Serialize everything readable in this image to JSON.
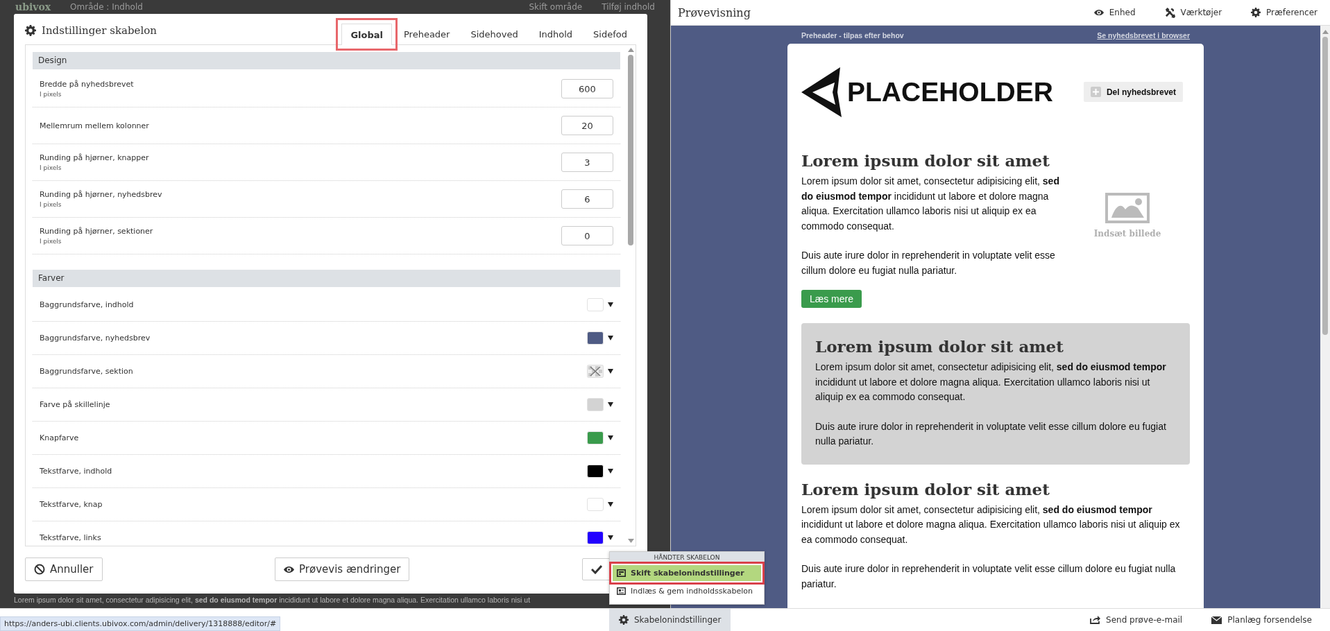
{
  "app": {
    "logo": "ubivox",
    "area": "Område : Indhold",
    "header_actions": [
      "Skift område",
      "Tilføj indhold"
    ],
    "background_text": "Lorem ipsum dolor sit amet, consectetur adipisicing elit, **sed do eiusmod tempor** incididunt ut labore et dolore magna aliqua. Exercitation ullamco laboris nisi ut"
  },
  "dialog": {
    "title": "Indstillinger skabelon",
    "tabs": [
      {
        "label": "Global",
        "selected": true,
        "annotated": true
      },
      {
        "label": "Preheader",
        "selected": false,
        "annotated": false
      },
      {
        "label": "Sidehoved",
        "selected": false,
        "annotated": false
      },
      {
        "label": "Indhold",
        "selected": false,
        "annotated": false
      },
      {
        "label": "Sidefod",
        "selected": false,
        "annotated": false
      }
    ],
    "sections": [
      {
        "title": "Design",
        "rows": [
          {
            "kind": "number",
            "label": "Bredde på nyhedsbrevet",
            "hint": "I pixels",
            "value": "600"
          },
          {
            "kind": "number",
            "label": "Mellemrum mellem kolonner",
            "value": "20"
          },
          {
            "kind": "number",
            "label": "Runding på hjørner, knapper",
            "hint": "I pixels",
            "value": "3"
          },
          {
            "kind": "number",
            "label": "Runding på hjørner, nyhedsbrev",
            "hint": "I pixels",
            "value": "6"
          },
          {
            "kind": "number",
            "label": "Runding på hjørner, sektioner",
            "hint": "I pixels",
            "value": "0"
          }
        ]
      },
      {
        "title": "Farver",
        "rows": [
          {
            "kind": "color",
            "label": "Baggrundsfarve, indhold",
            "color": "#ffffff"
          },
          {
            "kind": "color",
            "label": "Baggrundsfarve, nyhedsbrev",
            "color": "#4f5b84"
          },
          {
            "kind": "transparent",
            "label": "Baggrundsfarve, sektion"
          },
          {
            "kind": "color",
            "label": "Farve på skillelinje",
            "color": "#d3d3d3"
          },
          {
            "kind": "color",
            "label": "Knapfarve",
            "color": "#3a9b4c"
          },
          {
            "kind": "color",
            "label": "Tekstfarve, indhold",
            "color": "#000000"
          },
          {
            "kind": "color",
            "label": "Tekstfarve, knap",
            "color": "#ffffff"
          },
          {
            "kind": "color",
            "label": "Tekstfarve, links",
            "color": "#2200ff"
          }
        ]
      }
    ],
    "cancel": "Annuller",
    "preview": "Prøvevis ændringer"
  },
  "template_menu": {
    "heading": "HÅNDTER SKABELON",
    "items": [
      {
        "label": "Skift skabelonindstillinger",
        "selected": true,
        "annotated": true
      },
      {
        "label": "Indlæs & gem indholdsskabelon",
        "selected": false,
        "annotated": false
      }
    ],
    "button": "Skabelonindstillinger"
  },
  "preview": {
    "title": "Prøvevisning",
    "actions": [
      "Enhed",
      "Værktøjer",
      "Præferencer"
    ],
    "preheader": "Preheader - tilpas efter behov",
    "browser_link": "Se nyhedsbrevet i browser",
    "logo": "PLACEHOLDER",
    "share": "Del nyhedsbrevet",
    "blocks": [
      {
        "kind": "text-image",
        "heading": "Lorem ipsum dolor sit amet",
        "paragraphs": [
          "Lorem ipsum dolor sit amet, consectetur adipisicing elit, **sed do eiusmod tempor** incididunt ut labore et dolore magna aliqua. Exercitation ullamco laboris nisi ut aliquip ex ea commodo consequat.",
          "Duis aute irure dolor in reprehenderit in voluptate velit esse cillum dolore eu fugiat nulla pariatur."
        ],
        "image_label": "Indsæt billede",
        "button": "Læs mere"
      },
      {
        "kind": "boxed",
        "heading": "Lorem ipsum dolor sit amet",
        "paragraphs": [
          "Lorem ipsum dolor sit amet, consectetur adipisicing elit, **sed do eiusmod tempor** incididunt ut labore et dolore magna aliqua. Exercitation ullamco laboris nisi ut aliquip ex ea commodo consequat.",
          "Duis aute irure dolor in reprehenderit in voluptate velit esse cillum dolore eu fugiat nulla pariatur."
        ]
      },
      {
        "kind": "plain",
        "heading": "Lorem ipsum dolor sit amet",
        "paragraphs": [
          "Lorem ipsum dolor sit amet, consectetur adipisicing elit, **sed do eiusmod tempor** incididunt ut labore et dolore magna aliqua. Exercitation ullamco laboris nisi ut aliquip ex ea commodo consequat.",
          "Duis aute irure dolor in reprehenderit in voluptate velit esse cillum dolore eu fugiat nulla pariatur."
        ]
      }
    ]
  },
  "footer_actions": [
    "Send prøve-e-mail",
    "Planlæg forsendelse"
  ],
  "status_url": "https://anders-ubi.clients.ubivox.com/admin/delivery/1318888/editor/#"
}
